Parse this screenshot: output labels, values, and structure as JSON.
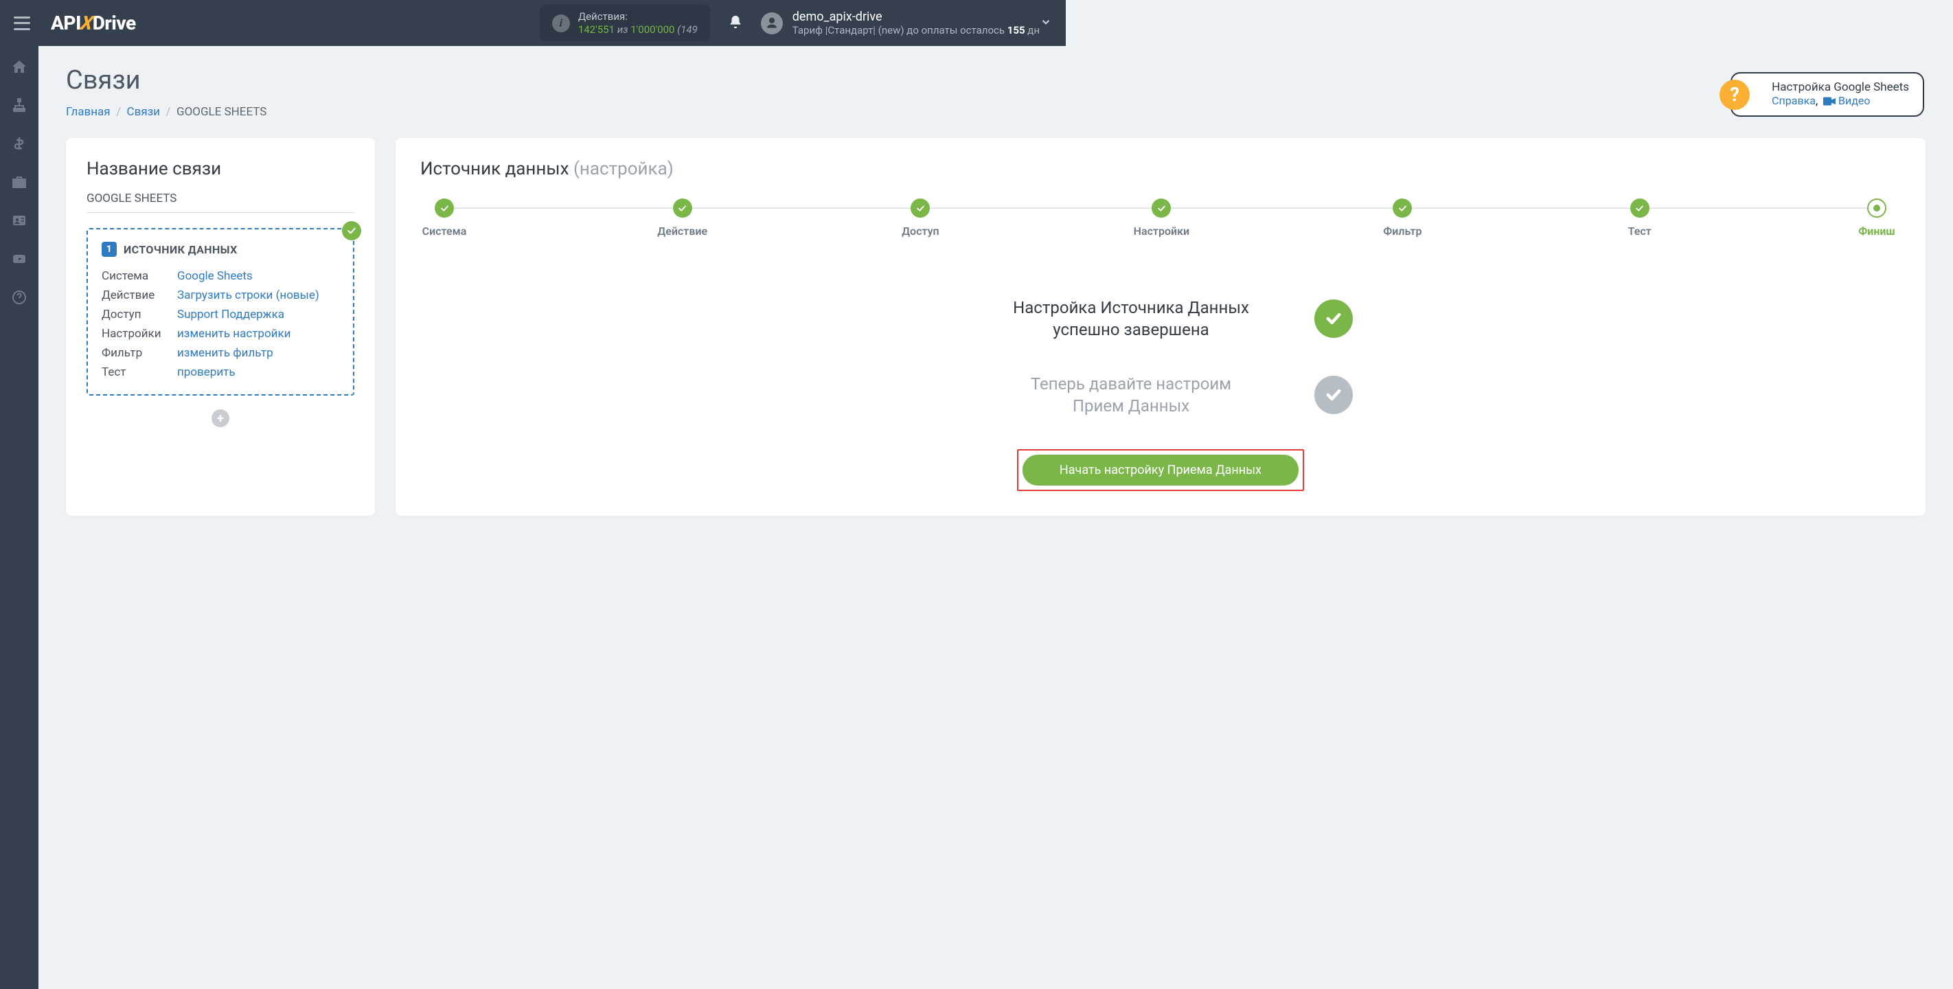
{
  "header": {
    "logo_parts": {
      "a": "API",
      "x": "X",
      "d": "Drive"
    },
    "actions_label": "Действия:",
    "actions_used": "142'551",
    "actions_mid": "из",
    "actions_total": "1'000'000",
    "actions_tail": "(149",
    "user_name": "demo_apix-drive",
    "plan_prefix": "Тариф |Стандарт| (new) до оплаты осталось ",
    "plan_days": "155",
    "plan_suffix": " дн"
  },
  "page": {
    "title": "Связи",
    "breadcrumb": {
      "home": "Главная",
      "links": "Связи",
      "current": "GOOGLE SHEETS"
    }
  },
  "help": {
    "title": "Настройка Google Sheets",
    "help_link": "Справка",
    "video_link": "Видео"
  },
  "leftcard": {
    "title": "Название связи",
    "name": "GOOGLE SHEETS",
    "source_num": "1",
    "source_title": "ИСТОЧНИК ДАННЫХ",
    "rows": [
      {
        "k": "Система",
        "v": "Google Sheets"
      },
      {
        "k": "Действие",
        "v": "Загрузить строки (новые)"
      },
      {
        "k": "Доступ",
        "v": "Support Поддержка"
      },
      {
        "k": "Настройки",
        "v": "изменить настройки"
      },
      {
        "k": "Фильтр",
        "v": "изменить фильтр"
      },
      {
        "k": "Тест",
        "v": "проверить"
      }
    ]
  },
  "rightcard": {
    "title": "Источник данных",
    "subtitle": "(настройка)",
    "steps": [
      "Система",
      "Действие",
      "Доступ",
      "Настройки",
      "Фильтр",
      "Тест",
      "Финиш"
    ],
    "current_step_index": 6,
    "status1_l1": "Настройка Источника Данных",
    "status1_l2": "успешно завершена",
    "status2_l1": "Теперь давайте настроим",
    "status2_l2": "Прием Данных",
    "cta": "Начать настройку Приема Данных"
  }
}
